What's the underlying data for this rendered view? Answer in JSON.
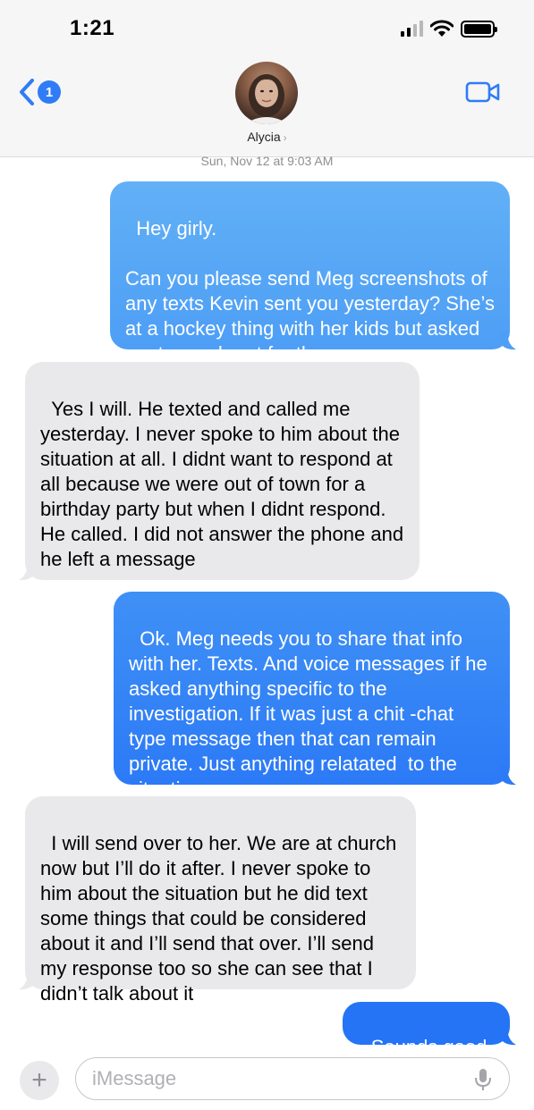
{
  "status_bar": {
    "time": "1:21"
  },
  "header": {
    "back_badge": "1",
    "contact_name": "Alycia",
    "name_chevron": "›"
  },
  "timestamp": {
    "day": "Sun, Nov 12 at",
    "time": "9:03 AM"
  },
  "messages": [
    {
      "sender": "me",
      "text": "Hey girly.\n\nCan you please send Meg screenshots of any texts Kevin sent you yesterday? She’s at a hockey thing with her kids but asked me to reach out for them."
    },
    {
      "sender": "them",
      "text": "Yes I will. He texted and called me yesterday. I never spoke to him about the situation at all. I didnt want to respond at all because we were out of town for a birthday party but when I didnt respond. He called. I did not answer the phone and he left a message"
    },
    {
      "sender": "me",
      "text": "Ok. Meg needs you to share that info with her. Texts. And voice messages if he asked anything specific to the investigation. If it was just a chit -chat type message then that can remain private. Just anything relatated  to the situation."
    },
    {
      "sender": "them",
      "text": "I will send over to her. We are at church now but I’ll do it after. I never spoke to him about the situation but he did text some things that could be considered about it and I’ll send that over. I’ll send my response too so she can see that I didn’t talk about it"
    },
    {
      "sender": "me",
      "text": "Sounds good."
    }
  ],
  "input": {
    "placeholder": "iMessage",
    "plus_label": "+"
  },
  "icons": {
    "back": "chevron-left-icon",
    "video": "video-camera-icon",
    "signal": "cellular-signal-icon",
    "wifi": "wifi-icon",
    "battery": "battery-icon",
    "plus": "plus-icon",
    "mic": "microphone-icon"
  },
  "colors": {
    "bubble_out_top": "#62b0f6",
    "bubble_out_bottom": "#2c7af6",
    "bubble_in": "#e9e9eb",
    "accent": "#2f7cf6"
  }
}
